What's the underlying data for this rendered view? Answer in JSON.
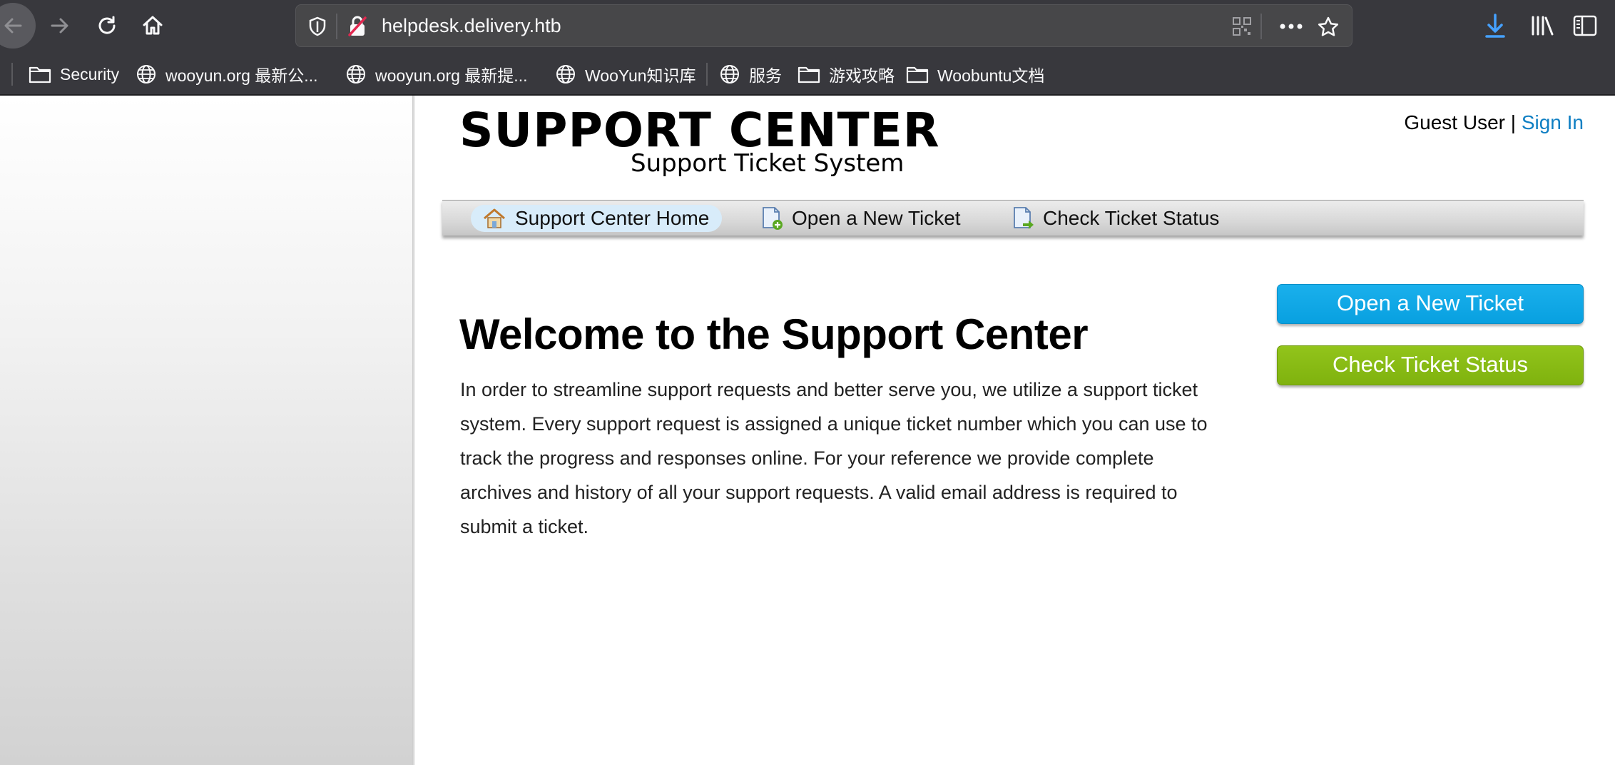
{
  "browser": {
    "url": "helpdesk.delivery.htb",
    "bookmarks": [
      {
        "label": "Security",
        "icon": "folder-icon"
      },
      {
        "label": "wooyun.org 最新公...",
        "icon": "globe-icon"
      },
      {
        "label": "wooyun.org 最新提...",
        "icon": "globe-icon"
      },
      {
        "label": "WooYun知识库",
        "icon": "globe-icon"
      },
      {
        "label": "服务",
        "icon": "globe-icon"
      },
      {
        "label": "游戏攻略",
        "icon": "folder-icon"
      },
      {
        "label": "Woobuntu文档",
        "icon": "folder-icon"
      }
    ]
  },
  "header": {
    "logo_title": "SUPPORT CENTER",
    "logo_subtitle": "Support Ticket System",
    "guest_label": "Guest User",
    "separator": "|",
    "sign_in": "Sign In"
  },
  "nav": {
    "items": [
      {
        "label": "Support Center Home",
        "icon": "home-icon",
        "active": true
      },
      {
        "label": "Open a New Ticket",
        "icon": "new-ticket-icon",
        "active": false
      },
      {
        "label": "Check Ticket Status",
        "icon": "ticket-status-icon",
        "active": false
      }
    ]
  },
  "main": {
    "title": "Welcome to the Support Center",
    "body": "In order to streamline support requests and better serve you, we utilize a support ticket system. Every support request is assigned a unique ticket number which you can use to track the progress and responses online. For your reference we provide complete archives and history of all your support requests. A valid email address is required to submit a ticket."
  },
  "sidebar_buttons": {
    "open_ticket": "Open a New Ticket",
    "check_status": "Check Ticket Status"
  },
  "colors": {
    "link": "#0f7fc3",
    "open_button": "#08a0e0",
    "status_button": "#7fb20e",
    "chrome_bg": "#38383d",
    "download_icon": "#45a1ff"
  }
}
